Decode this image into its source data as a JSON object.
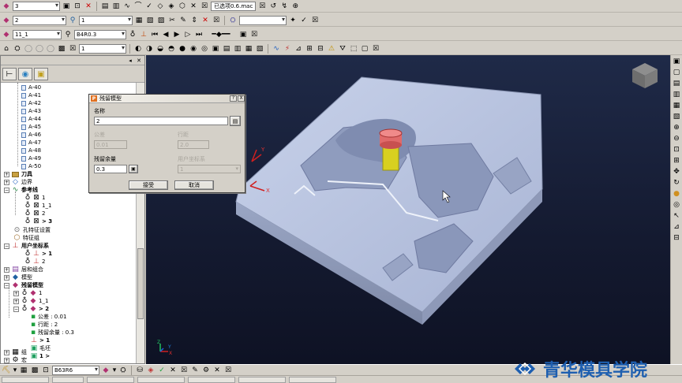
{
  "toolbar1": {
    "combo1": "3",
    "macro_label": "已选项0.6.mac"
  },
  "toolbar2": {
    "combo_tool_left": "2",
    "combo_tool_right": "1"
  },
  "toolbar3": {
    "layer_combo": "11_1",
    "tool_combo": "B4R0.3"
  },
  "toolbar4": {
    "combo": "1"
  },
  "explorer": {
    "items": {
      "a40": "A-40",
      "a41": "A-41",
      "a42": "A-42",
      "a43": "A-43",
      "a44": "A-44",
      "a45": "A-45",
      "a46": "A-46",
      "a47": "A-47",
      "a48": "A-48",
      "a49": "A-49",
      "a50": "A-50",
      "tools": "刀具",
      "boundary": "边界",
      "reference": "参考线",
      "ref1": "1",
      "ref11": "1_1",
      "ref2": "2",
      "ref3": "> 3",
      "hole_feature": "孔特征设置",
      "feature": "特征组",
      "ucs": "用户坐标系",
      "ucs1": "> 1",
      "ucs2": "2",
      "layers": "层和组合",
      "model": "模型",
      "stock_model": "残留模型",
      "sm1": "1",
      "sm11": "1_1",
      "sm2": "> 2",
      "tolerance": "公差 : 0.01",
      "stepover": "行距 : 2",
      "allowance": "残留余量 : 0.3",
      "sub1": "> 1",
      "blank": "毛坯",
      "sub1b": "1 >",
      "group": "组",
      "macro": "宏"
    }
  },
  "dialog": {
    "title": "残留模型",
    "name_label": "名称",
    "name_value": "2",
    "tolerance_label": "公差",
    "tolerance_value": "0.01",
    "stepover_label": "行距",
    "stepover_value": "2.0",
    "allowance_label": "残留余量",
    "allowance_value": "0.3",
    "ucs_label": "用户坐标系",
    "ucs_value": "1",
    "accept": "接受",
    "cancel": "取消",
    "help": "?",
    "close": "X"
  },
  "statusbar": {
    "tool_name": "B63R6"
  },
  "brand": {
    "text": "青华模具学院",
    "color": "#1e5fb0"
  },
  "colors": {
    "viewport_bg": "#1a2240",
    "part": "#b8c4e0",
    "tool_tip": "#e06a6a",
    "tool_shank": "#d6d020"
  }
}
